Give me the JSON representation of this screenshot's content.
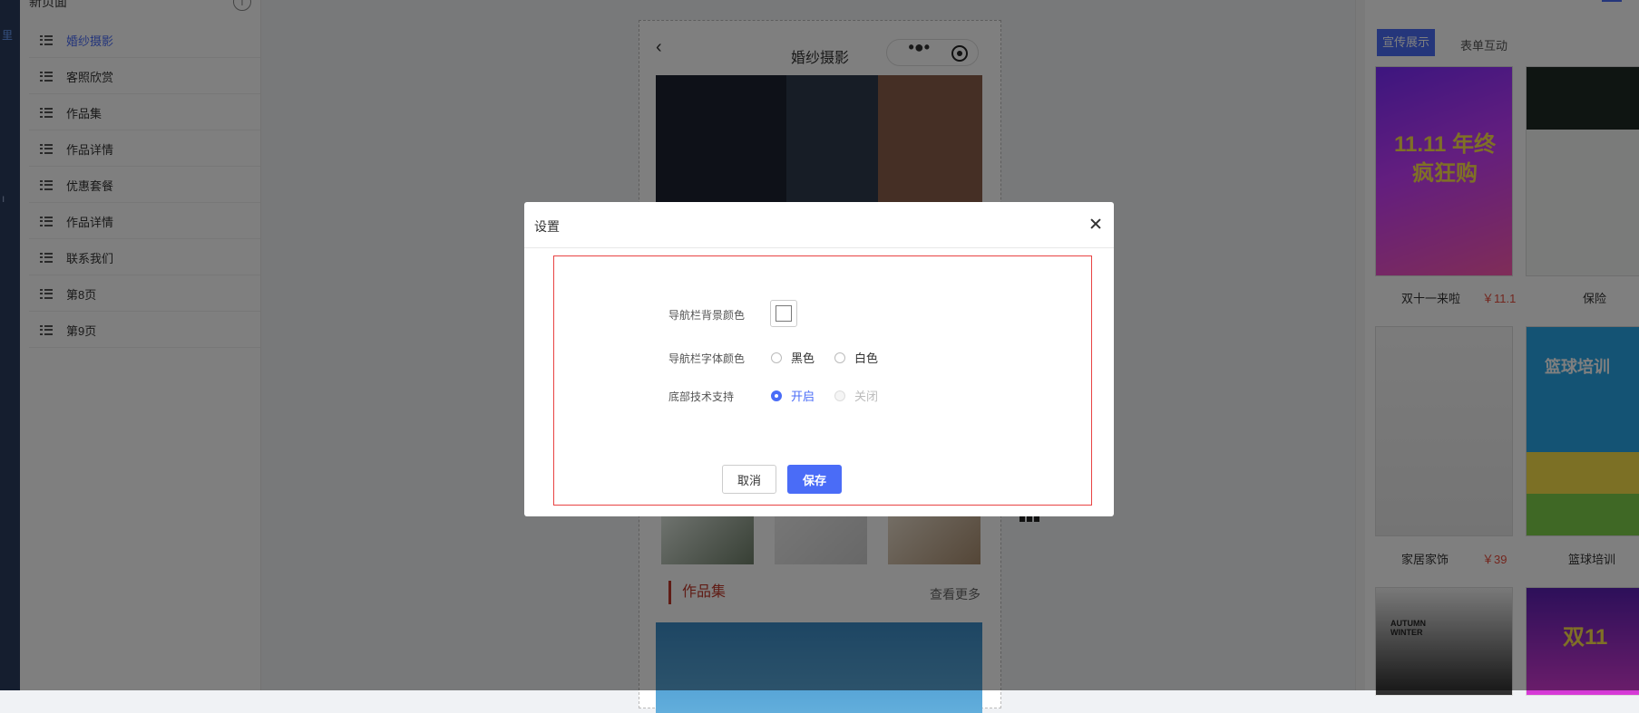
{
  "left_rail": {
    "marks": [
      "里",
      "ı"
    ]
  },
  "pages_panel": {
    "header": "新页面",
    "info_icon": "i",
    "items": [
      {
        "label": "婚纱摄影",
        "active": true
      },
      {
        "label": "客照欣赏"
      },
      {
        "label": "作品集"
      },
      {
        "label": "作品详情"
      },
      {
        "label": "优惠套餐"
      },
      {
        "label": "作品详情"
      },
      {
        "label": "联系我们"
      },
      {
        "label": "第8页"
      },
      {
        "label": "第9页"
      }
    ]
  },
  "phone": {
    "back_icon": "‹",
    "title": "婚纱摄影",
    "menu_icon": "•●•",
    "section_title": "作品集",
    "more_link": "查看更多"
  },
  "templates": {
    "tabs": [
      "宣传展示",
      "表单互动"
    ],
    "items": [
      {
        "name": "双十一来啦",
        "price": "￥11.1",
        "poster_text": "11.11 年终疯狂购"
      },
      {
        "name": "保险",
        "price": ""
      },
      {
        "name": "家居家饰",
        "price": "￥39"
      },
      {
        "name": "篮球培训",
        "price": "",
        "poster_text": "篮球培训"
      },
      {
        "poster_text": "AUTUMN WINTER"
      },
      {
        "poster_text": "双11"
      }
    ]
  },
  "dialog": {
    "title": "设置",
    "fields": {
      "nav_bg_color": {
        "label": "导航栏背景颜色",
        "value": "#ffffff"
      },
      "nav_font_color": {
        "label": "导航栏字体颜色",
        "options": [
          {
            "label": "黑色",
            "checked": false
          },
          {
            "label": "白色",
            "checked": false
          }
        ]
      },
      "footer_support": {
        "label": "底部技术支持",
        "options": [
          {
            "label": "开启",
            "checked": true
          },
          {
            "label": "关闭",
            "checked": false,
            "disabled": true
          }
        ]
      }
    },
    "cancel_label": "取消",
    "save_label": "保存"
  },
  "colors": {
    "accent": "#4a6cf7",
    "highlight_border": "#e84343",
    "price": "#e74c3c"
  }
}
